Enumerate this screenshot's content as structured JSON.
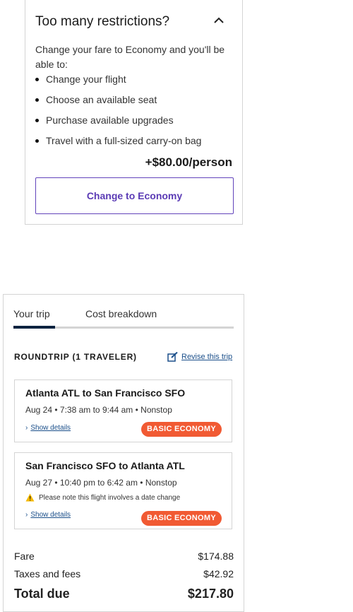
{
  "restrictions": {
    "title": "Too many restrictions?",
    "description": "Change your fare to Economy and you'll be able to:",
    "benefits": [
      "Change your flight",
      "Choose an available seat",
      "Purchase available upgrades",
      "Travel with a full-sized carry-on bag"
    ],
    "price": "+$80.00/person",
    "button_label": "Change to Economy"
  },
  "trip": {
    "tabs": [
      "Your trip",
      "Cost breakdown"
    ],
    "active_tab": "Your trip",
    "roundtrip_label": "ROUNDTRIP (1 TRAVELER)",
    "revise_label": "Revise this trip",
    "flights": [
      {
        "route": "Atlanta ATL to San Francisco SFO",
        "times": "Aug 24 • 7:38 am to 9:44 am • Nonstop",
        "note": "",
        "show_details": "Show details",
        "badge": "BASIC ECONOMY"
      },
      {
        "route": "San Francisco SFO to Atlanta ATL",
        "times": "Aug 27 • 10:40 pm to 6:42 am • Nonstop",
        "note": "Please note this flight involves a date change",
        "show_details": "Show details",
        "badge": "BASIC ECONOMY"
      }
    ],
    "costs": {
      "fare_label": "Fare",
      "fare_value": "$174.88",
      "taxes_label": "Taxes and fees",
      "taxes_value": "$42.92",
      "total_label": "Total due",
      "total_value": "$217.80"
    }
  },
  "colors": {
    "accent_purple": "#6244bb",
    "badge_orange": "#f15a33",
    "link_blue": "#1b4f8a",
    "tab_active": "#0c2340",
    "warning_yellow": "#f5b800"
  },
  "icons": [
    "chevron-up-icon",
    "edit-icon",
    "warning-icon",
    "chevron-right-icon"
  ]
}
